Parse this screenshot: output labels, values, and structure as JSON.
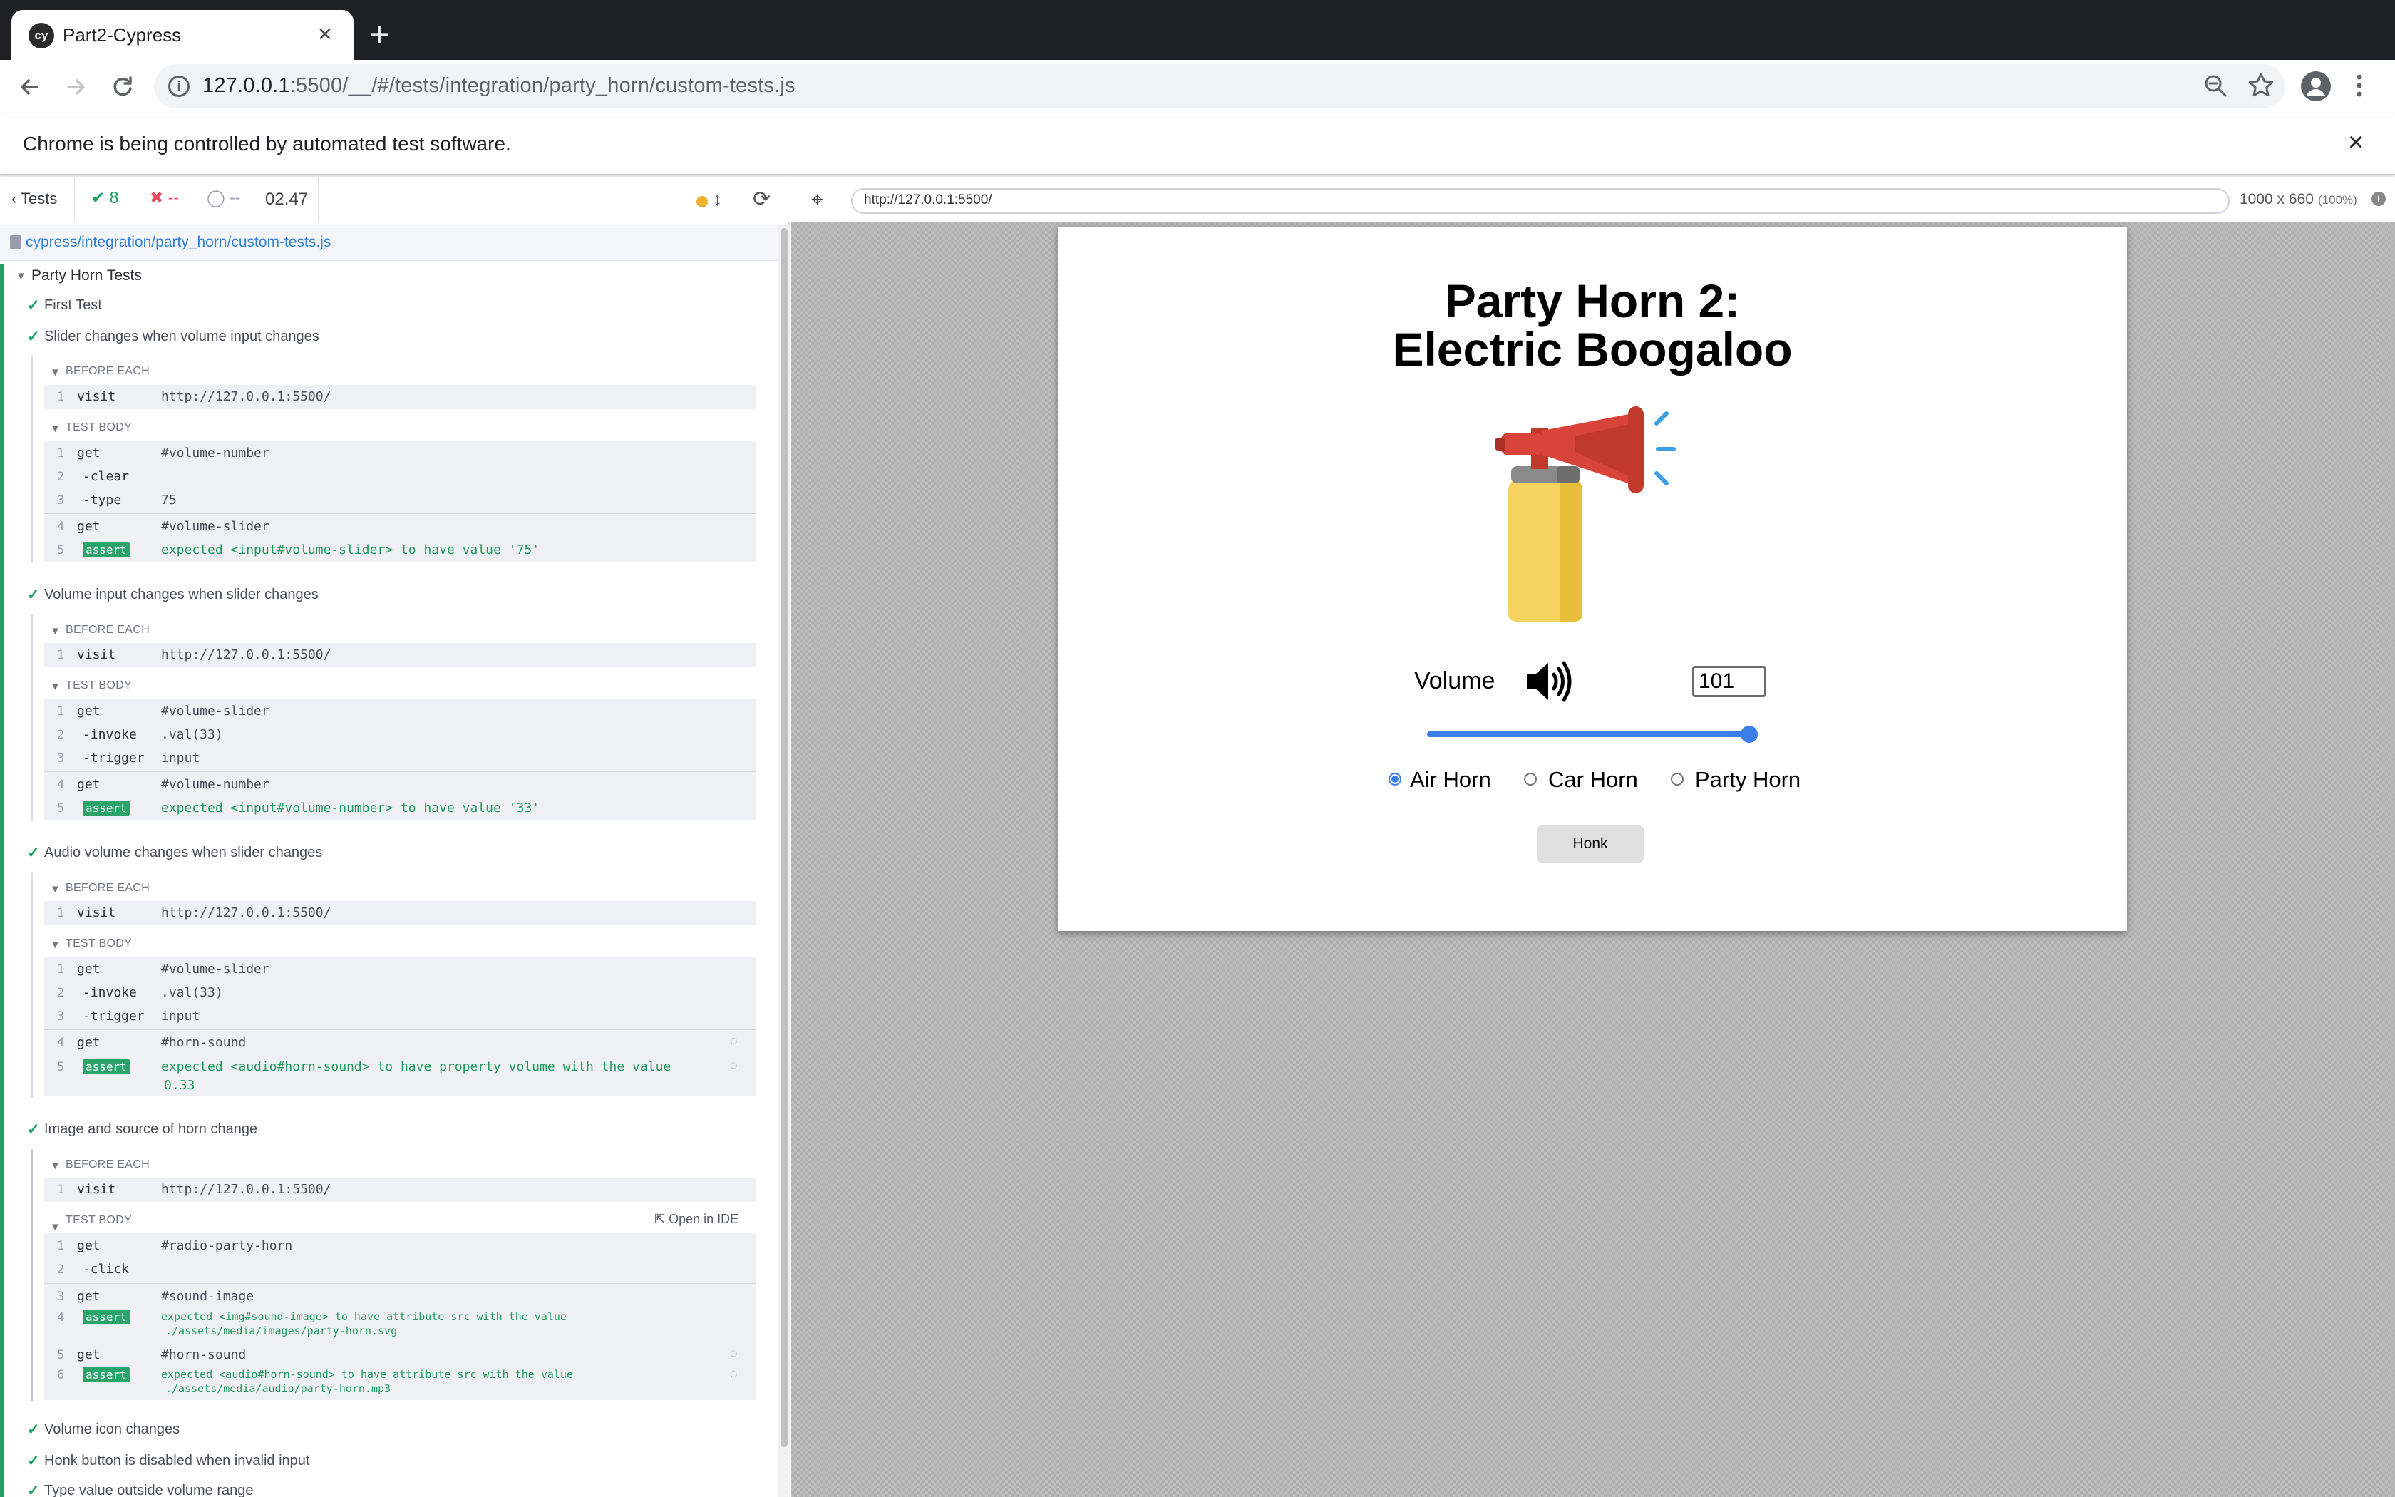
{
  "browser": {
    "tab_title": "Part2-Cypress",
    "favicon_text": "cy",
    "url_host": "127.0.0.1",
    "url_rest": ":5500/__/#/tests/integration/party_horn/custom-tests.js",
    "automation_notice": "Chrome is being controlled by automated test software."
  },
  "reporter": {
    "back_label": "Tests",
    "passed": "8",
    "failed": "--",
    "pending": "--",
    "duration": "02.47",
    "spec_path": "cypress/integration/party_horn/custom-tests.js",
    "suite_title": "Party Horn Tests",
    "hooks": {
      "before_each": "BEFORE EACH",
      "test_body": "TEST BODY"
    },
    "open_in_ide": "Open in IDE",
    "tests": [
      {
        "title": "First Test"
      },
      {
        "title": "Slider changes when volume input changes",
        "before": {
          "num": "1",
          "name": "visit",
          "msg": "http://127.0.0.1:5500/"
        },
        "body": [
          {
            "num": "1",
            "name": "get",
            "msg": "#volume-number"
          },
          {
            "num": "2",
            "name": "-clear",
            "msg": ""
          },
          {
            "num": "3",
            "name": "-type",
            "msg": "75"
          },
          {
            "num": "4",
            "name": "get",
            "msg": "#volume-slider"
          },
          {
            "num": "5",
            "name": "-assert",
            "badge": "assert",
            "msg": "expected <input#volume-slider> to have value '75'"
          }
        ]
      },
      {
        "title": "Volume input changes when slider changes",
        "before": {
          "num": "1",
          "name": "visit",
          "msg": "http://127.0.0.1:5500/"
        },
        "body": [
          {
            "num": "1",
            "name": "get",
            "msg": "#volume-slider"
          },
          {
            "num": "2",
            "name": "-invoke",
            "msg": ".val(33)"
          },
          {
            "num": "3",
            "name": "-trigger",
            "msg": "input"
          },
          {
            "num": "4",
            "name": "get",
            "msg": "#volume-number"
          },
          {
            "num": "5",
            "name": "-assert",
            "badge": "assert",
            "msg": "expected <input#volume-number> to have value '33'"
          }
        ]
      },
      {
        "title": "Audio volume changes when slider changes",
        "before": {
          "num": "1",
          "name": "visit",
          "msg": "http://127.0.0.1:5500/"
        },
        "body": [
          {
            "num": "1",
            "name": "get",
            "msg": "#volume-slider"
          },
          {
            "num": "2",
            "name": "-invoke",
            "msg": ".val(33)"
          },
          {
            "num": "3",
            "name": "-trigger",
            "msg": "input"
          },
          {
            "num": "4",
            "name": "get",
            "msg": "#horn-sound"
          },
          {
            "num": "5",
            "name": "-assert",
            "badge": "assert",
            "msg": "expected <audio#horn-sound> to have property volume with the value",
            "msg2": "0.33"
          }
        ]
      },
      {
        "title": "Image and source of horn change",
        "before": {
          "num": "1",
          "name": "visit",
          "msg": "http://127.0.0.1:5500/"
        },
        "body": [
          {
            "num": "1",
            "name": "get",
            "msg": "#radio-party-horn"
          },
          {
            "num": "2",
            "name": "-click",
            "msg": ""
          },
          {
            "num": "3",
            "name": "get",
            "msg": "#sound-image"
          },
          {
            "num": "4",
            "name": "-assert",
            "badge": "assert",
            "msg": "expected <img#sound-image> to have attribute src with the value",
            "msg2": "./assets/media/images/party-horn.svg"
          },
          {
            "num": "5",
            "name": "get",
            "msg": "#horn-sound"
          },
          {
            "num": "6",
            "name": "-assert",
            "badge": "assert",
            "msg": "expected <audio#horn-sound> to have attribute src with the value",
            "msg2": "./assets/media/audio/party-horn.mp3"
          }
        ]
      },
      {
        "title": "Volume icon changes"
      },
      {
        "title": "Honk button is disabled when invalid input"
      },
      {
        "title": "Type value outside volume range"
      }
    ]
  },
  "aut": {
    "url": "http://127.0.0.1:5500/",
    "viewport": "1000 x 660",
    "scale": "(100%)"
  },
  "app": {
    "title_line1": "Party Horn 2:",
    "title_line2": "Electric Boogaloo",
    "volume_label": "Volume",
    "volume_value": "101",
    "slider_fraction": 1.0,
    "radios": [
      {
        "label": "Air Horn",
        "checked": true
      },
      {
        "label": "Car Horn",
        "checked": false
      },
      {
        "label": "Party Horn",
        "checked": false
      }
    ],
    "honk_label": "Honk",
    "accent_color": "#3b7ee8"
  }
}
